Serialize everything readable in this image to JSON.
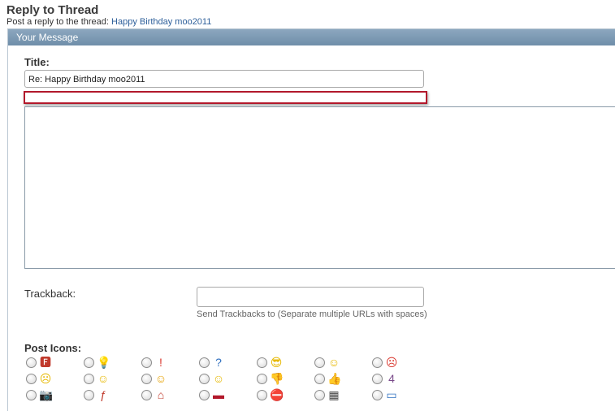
{
  "header": {
    "title": "Reply to Thread",
    "subtitle_prefix": "Post a reply to the thread:",
    "thread_link": "Happy Birthday moo2011"
  },
  "panel": {
    "title": "Your Message"
  },
  "form": {
    "title_label": "Title:",
    "title_value": "Re: Happy Birthday  moo2011",
    "trackback_label": "Trackback:",
    "trackback_value": "",
    "trackback_hint": "Send Trackbacks to (Separate multiple URLs with spaces)",
    "post_icons_label": "Post Icons:"
  },
  "colors": {
    "accent": "#b2182b",
    "panel_header": "#7d99b2",
    "link": "#2d5f9a"
  },
  "post_icons": [
    {
      "name": "fs-icon",
      "glyph": "🅵",
      "color": "#c0392b"
    },
    {
      "name": "lightbulb-icon",
      "glyph": "💡",
      "color": "#e6b800"
    },
    {
      "name": "exclamation-icon",
      "glyph": "!",
      "color": "#d9342b"
    },
    {
      "name": "question-icon",
      "glyph": "?",
      "color": "#2f6fbf"
    },
    {
      "name": "cool-icon",
      "glyph": "😎",
      "color": "#e6b800"
    },
    {
      "name": "smile-icon",
      "glyph": "☺",
      "color": "#e6b800"
    },
    {
      "name": "angry-icon",
      "glyph": "☹",
      "color": "#d9342b"
    },
    {
      "name": "frown-icon",
      "glyph": "☹",
      "color": "#e6b800"
    },
    {
      "name": "grin-icon",
      "glyph": "☺",
      "color": "#e6b800"
    },
    {
      "name": "wink-icon",
      "glyph": "☺",
      "color": "#e6a100"
    },
    {
      "name": "tongue-icon",
      "glyph": "☺",
      "color": "#e6b800"
    },
    {
      "name": "thumbs-down-icon",
      "glyph": "👎",
      "color": "#d88a5a"
    },
    {
      "name": "thumbs-up-icon",
      "glyph": "👍",
      "color": "#e0a37a"
    },
    {
      "name": "four-icon",
      "glyph": "4",
      "color": "#7a4a8a"
    },
    {
      "name": "camera-icon",
      "glyph": "📷",
      "color": "#555555"
    },
    {
      "name": "flash-icon",
      "glyph": "ƒ",
      "color": "#c0392b"
    },
    {
      "name": "home-icon",
      "glyph": "⌂",
      "color": "#c0392b"
    },
    {
      "name": "car-icon",
      "glyph": "▬",
      "color": "#b2182b"
    },
    {
      "name": "no-entry-icon",
      "glyph": "⛔",
      "color": "#b2182b"
    },
    {
      "name": "film-icon",
      "glyph": "▦",
      "color": "#444444"
    },
    {
      "name": "monitor-icon",
      "glyph": "▭",
      "color": "#2f6fbf"
    }
  ]
}
